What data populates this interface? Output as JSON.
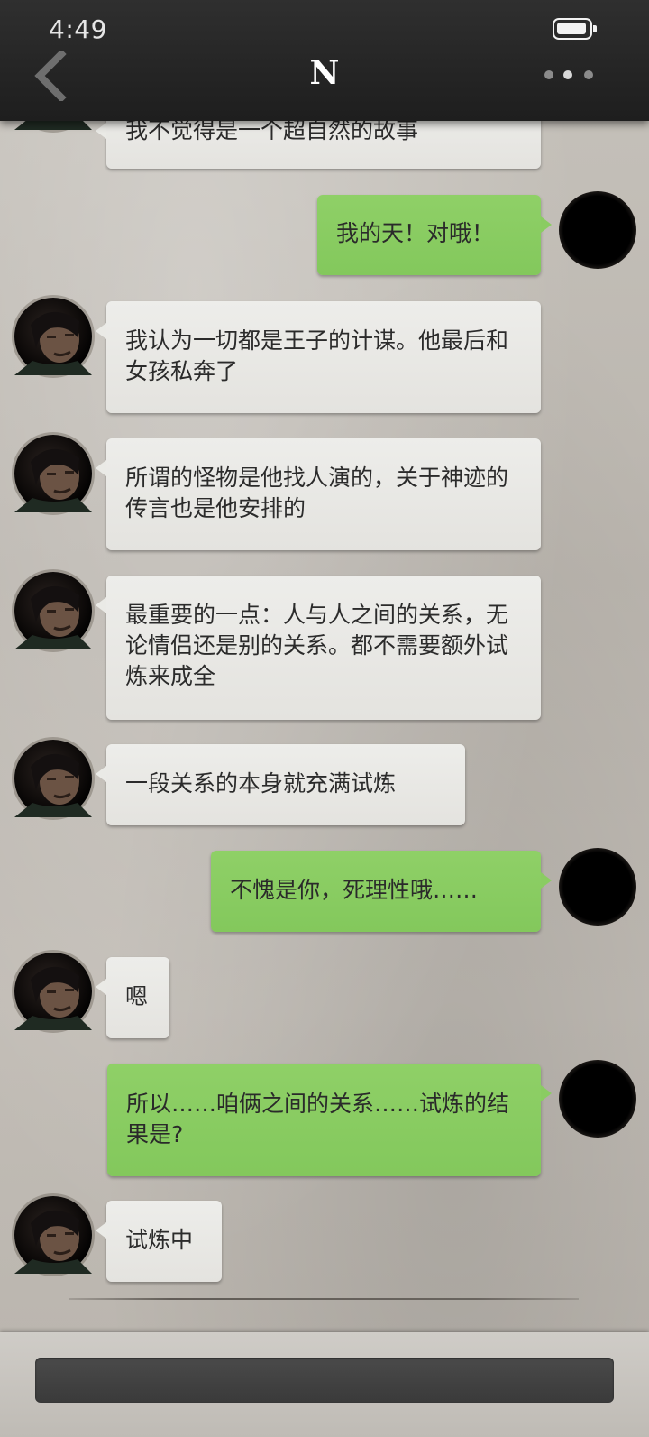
{
  "status_bar": {
    "time": "4:49"
  },
  "header": {
    "title": "N"
  },
  "messages": [
    {
      "from": "contact",
      "text": "我不觉得是一个超自然的故事"
    },
    {
      "from": "me",
      "text": "我的天！对哦！"
    },
    {
      "from": "contact",
      "text": "我认为一切都是王子的计谋。他最后和女孩私奔了"
    },
    {
      "from": "contact",
      "text": "所谓的怪物是他找人演的，关于神迹的传言也是他安排的"
    },
    {
      "from": "contact",
      "text": "最重要的一点：人与人之间的关系，无论情侣还是别的关系。都不需要额外试炼来成全"
    },
    {
      "from": "contact",
      "text": "一段关系的本身就充满试炼"
    },
    {
      "from": "me",
      "text": "不愧是你，死理性哦……"
    },
    {
      "from": "contact",
      "text": "嗯"
    },
    {
      "from": "me",
      "text": "所以……咱俩之间的关系……试炼的结果是?"
    },
    {
      "from": "contact",
      "text": "试炼中"
    }
  ],
  "colors": {
    "outgoing_bubble": "#8acc62",
    "incoming_bubble": "#eaeae6",
    "header": "#262626"
  }
}
